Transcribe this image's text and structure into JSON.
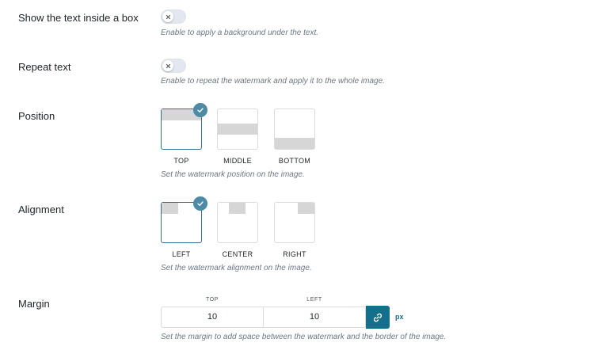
{
  "box_setting": {
    "label": "Show the text inside a box",
    "description": "Enable to apply a background under the text."
  },
  "repeat_setting": {
    "label": "Repeat text",
    "description": "Enable to repeat the watermark and apply it to the whole image."
  },
  "position_setting": {
    "label": "Position",
    "options": [
      "TOP",
      "MIDDLE",
      "BOTTOM"
    ],
    "selected": "TOP",
    "description": "Set the watermark position on the image."
  },
  "alignment_setting": {
    "label": "Alignment",
    "options": [
      "LEFT",
      "CENTER",
      "RIGHT"
    ],
    "selected": "LEFT",
    "description": "Set the watermark alignment on the image."
  },
  "margin_setting": {
    "label": "Margin",
    "top_label": "TOP",
    "left_label": "LEFT",
    "top_value": "10",
    "left_value": "10",
    "unit": "px",
    "description": "Set the margin to add space between the watermark and the border of the image."
  },
  "colors": {
    "accent": "#136f8b",
    "check_badge": "#4d8aa6",
    "placeholder_bar": "#d6d6d6"
  },
  "icons": {
    "toggle_off": "close-icon",
    "selected": "checkmark-icon",
    "link": "link-icon"
  }
}
